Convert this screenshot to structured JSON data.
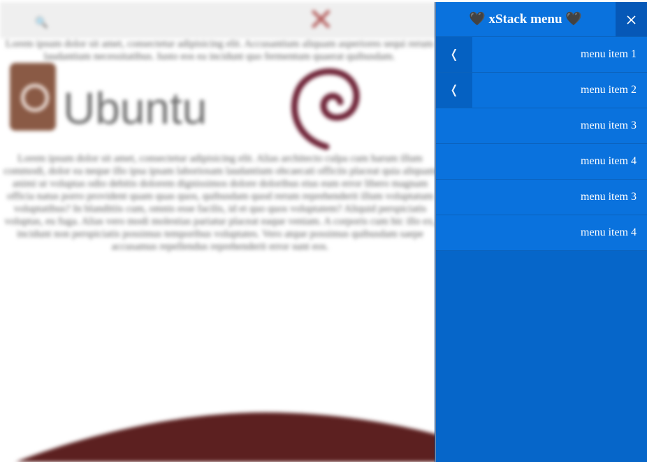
{
  "menu": {
    "title": "🖤 xStack menu 🖤",
    "close_icon": "close-icon",
    "submenu_arrow_glyph": "❬",
    "items": [
      {
        "label": "menu item 1",
        "has_submenu": true
      },
      {
        "label": "menu item 2",
        "has_submenu": true
      },
      {
        "label": "menu item 3",
        "has_submenu": false
      },
      {
        "label": "menu item 4",
        "has_submenu": false
      },
      {
        "label": "menu item 3",
        "has_submenu": false
      },
      {
        "label": "menu item 4",
        "has_submenu": false
      }
    ]
  },
  "background": {
    "search_glyph": "🔍",
    "logo_glyph": "✕",
    "logo_word": "Ubuntu",
    "paragraph_1": "Lorem ipsum dolor sit amet, consectetur adipisicing elit. Accusantium aliquam asperiores sequi rerum laudantium necessitatibus. Iusto eos ea incidunt quo fermentum quaerat quibusdam.",
    "paragraph_2": "Lorem ipsum dolor sit amet, consectetur adipisicing elit. Alias architecto culpa cum harum illum commodi, dolor ea neque illo ipsa ipsam laboriosam laudantium obcaecati officiis placeat quia aliquam animi ut voluptas odio debitis dolorem dignissimos dolore doloribus eius eum error libero magnam officia natus porro provident quam quas quos, quibusdam quod rerum reprehenderit illum voluptatum voluptatibus? In blanditiis cum, omnis esse facilis, id et quo quos voluptatem? Aliquid perspiciatis voluptas, eu fuga. Alias vero modi molestias pariatur placeat eaque veniam. A corporis cum hic illo ex, incidunt non perspiciatis possimus temporibus voluptates. Vero atque possimus quibusdam saepe accusamus repellendus reprehenderit error sunt eos.",
    "colors": {
      "logo_red": "#b35a59",
      "ubuntu_brown": "#8a5a45",
      "debian_swirl": "#6e2236",
      "wave": "#5c2020"
    }
  },
  "colors": {
    "menu_bg": "#0666c9",
    "menu_item": "#0a72dd",
    "menu_arrow_cell": "#0561c2",
    "close_button": "#0658b7",
    "text": "#ffffff"
  }
}
